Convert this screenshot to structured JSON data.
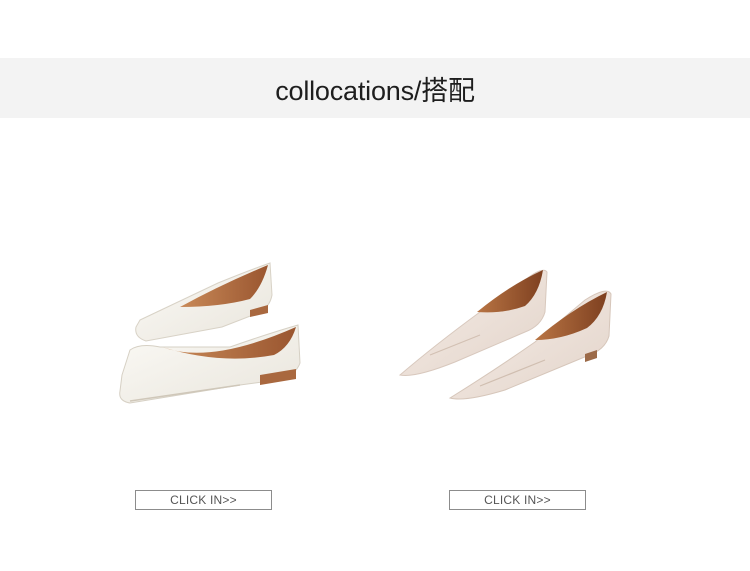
{
  "header": {
    "title": "collocations/搭配"
  },
  "products": [
    {
      "image": "white-square-toe-flat-shoes",
      "cta_label": "CLICK IN>>"
    },
    {
      "image": "cream-pointed-toe-loafers",
      "cta_label": "CLICK IN>>"
    }
  ],
  "colors": {
    "header_band": "#f3f3f3",
    "button_border": "#8c8c8c",
    "button_text": "#555555",
    "shoe_white": "#f4f1ea",
    "shoe_cream": "#efe4dc",
    "lining_tan": "#b56a3c"
  }
}
